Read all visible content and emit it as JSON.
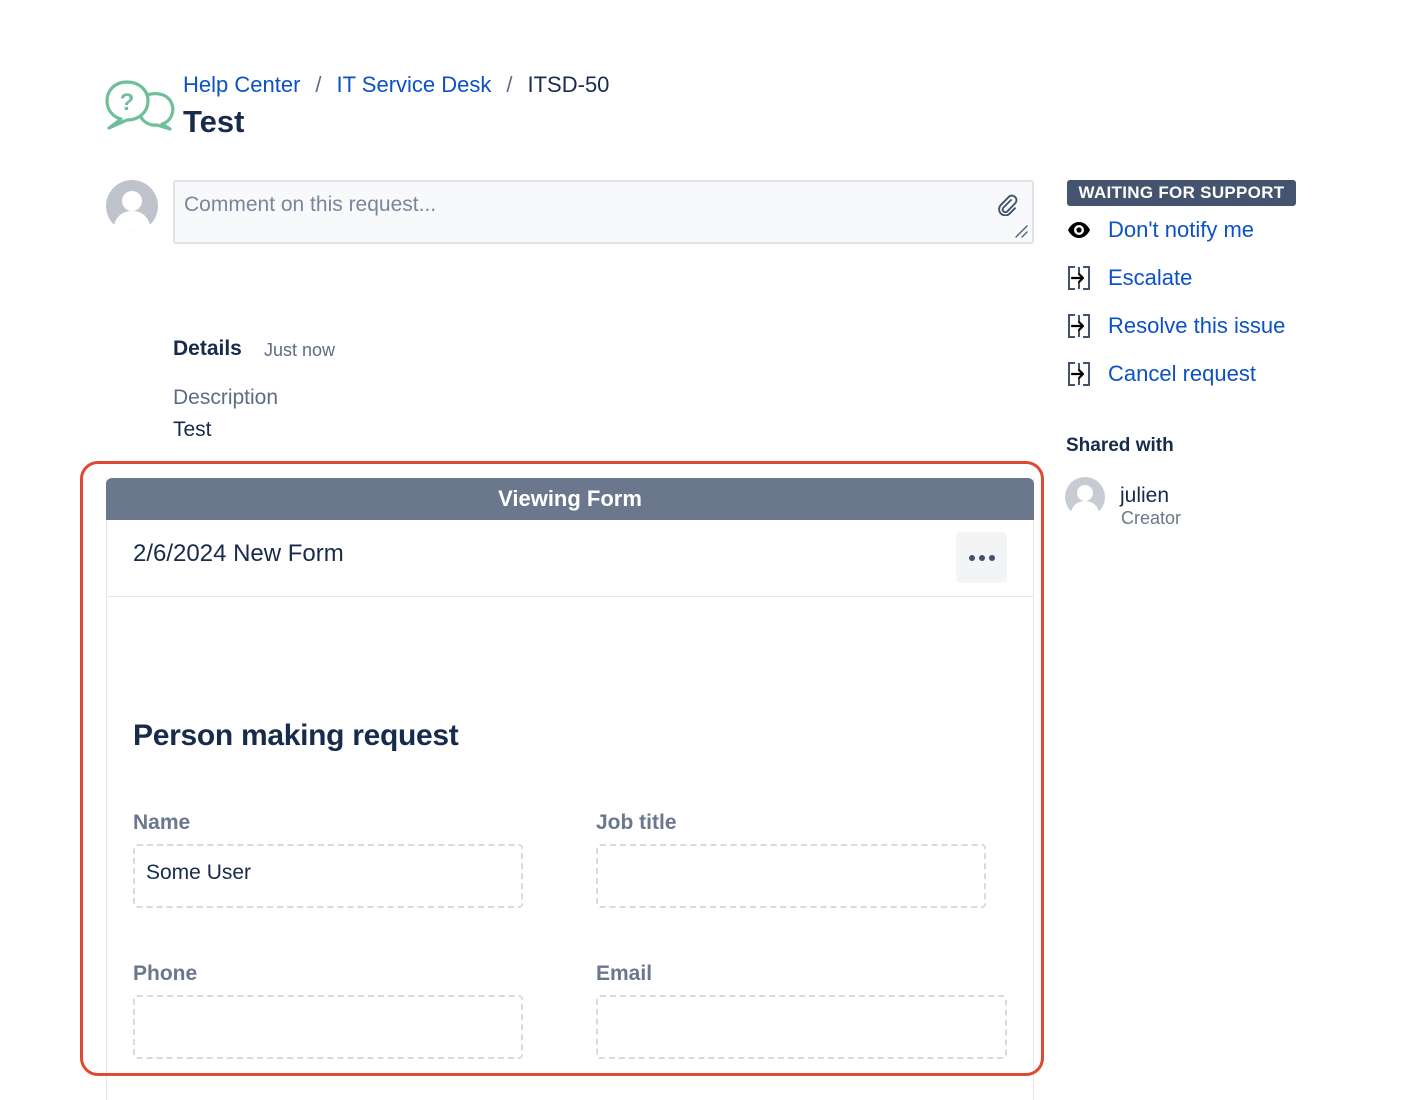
{
  "header": {
    "breadcrumb": [
      "Help Center",
      "IT Service Desk",
      "ITSD-50"
    ],
    "breadcrumb_separator": "/",
    "title": "Test"
  },
  "comment": {
    "placeholder": "Comment on this request..."
  },
  "details": {
    "label": "Details",
    "timestamp": "Just now",
    "description_label": "Description",
    "description_value": "Test"
  },
  "form": {
    "header": "Viewing Form",
    "title": "2/6/2024 New Form",
    "section_title": "Person making request",
    "fields": [
      {
        "label": "Name",
        "value": "Some User"
      },
      {
        "label": "Job title",
        "value": ""
      },
      {
        "label": "Phone",
        "value": ""
      },
      {
        "label": "Email",
        "value": ""
      }
    ]
  },
  "sidebar": {
    "status": "WAITING FOR SUPPORT",
    "actions": [
      {
        "label": "Don't notify me",
        "icon": "eye-icon"
      },
      {
        "label": "Escalate",
        "icon": "transition-icon"
      },
      {
        "label": "Resolve this issue",
        "icon": "transition-icon"
      },
      {
        "label": "Cancel request",
        "icon": "transition-icon"
      }
    ],
    "shared_with_label": "Shared with",
    "shared_users": [
      {
        "name": "julien",
        "role": "Creator"
      }
    ]
  },
  "colors": {
    "link": "#0c51c6",
    "status_badge": "#44546f",
    "form_header": "#6b778c",
    "highlight": "#e0492f",
    "logo": "#6fbf9a"
  }
}
